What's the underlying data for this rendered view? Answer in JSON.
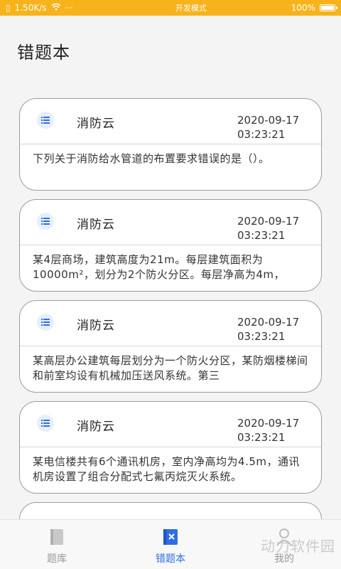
{
  "status_bar": {
    "network_speed": "1.50K/s",
    "mode_text": "开发模式",
    "battery_percent": "100%",
    "battery_level": 1.0
  },
  "page": {
    "title": "错题本"
  },
  "cards": [
    {
      "source": "消防云",
      "date": "2020-09-17",
      "time": "03:23:21",
      "content": "下列关于消防给水管道的布置要求错误的是（）。"
    },
    {
      "source": "消防云",
      "date": "2020-09-17",
      "time": "03:23:21",
      "content": "某4层商场，建筑高度为21m。每层建筑面积为10000m²，划分为2个防火分区。每层净高为4m，"
    },
    {
      "source": "消防云",
      "date": "2020-09-17",
      "time": "03:23:21",
      "content": "某高层办公建筑每层划分为一个防火分区，某防烟楼梯间和前室均设有机械加压送风系统。第三"
    },
    {
      "source": "消防云",
      "date": "2020-09-17",
      "time": "03:23:21",
      "content": "某电信楼共有6个通讯机房，室内净高均为4.5m，通讯机房设置了组合分配式七氟丙烷灭火系统。"
    }
  ],
  "bottom_nav": {
    "items": [
      {
        "label": "题库",
        "icon": "book-icon"
      },
      {
        "label": "错题本",
        "icon": "wrong-questions-icon"
      },
      {
        "label": "我的",
        "icon": "user-icon"
      }
    ],
    "active_index": 1,
    "active_color": "#2f6fe0"
  },
  "watermark": "动力软件园"
}
